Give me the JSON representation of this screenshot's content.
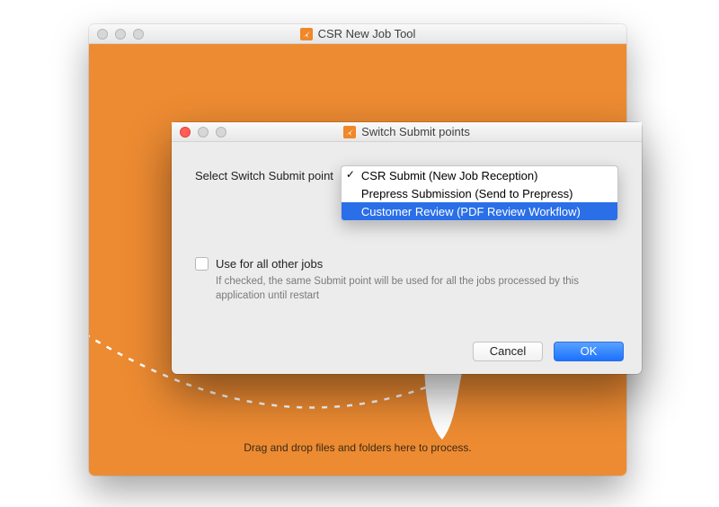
{
  "bg": {
    "title": "CSR New Job Tool",
    "drop_text": "Drag and drop files and folders here to process."
  },
  "dialog": {
    "title": "Switch Submit points",
    "select_label": "Select Switch Submit point",
    "options": [
      {
        "label": "CSR Submit (New Job Reception)",
        "checked": true,
        "selected": false
      },
      {
        "label": "Prepress Submission (Send to Prepress)",
        "checked": false,
        "selected": false
      },
      {
        "label": "Customer Review (PDF Review Workflow)",
        "checked": false,
        "selected": true
      }
    ],
    "checkbox_label": "Use for all other jobs",
    "help_text": "If checked, the same Submit point will be used for all the jobs processed by this application until restart",
    "cancel_label": "Cancel",
    "ok_label": "OK"
  },
  "colors": {
    "accent": "#ed8b32",
    "primary_blue": "#1b72ff"
  }
}
